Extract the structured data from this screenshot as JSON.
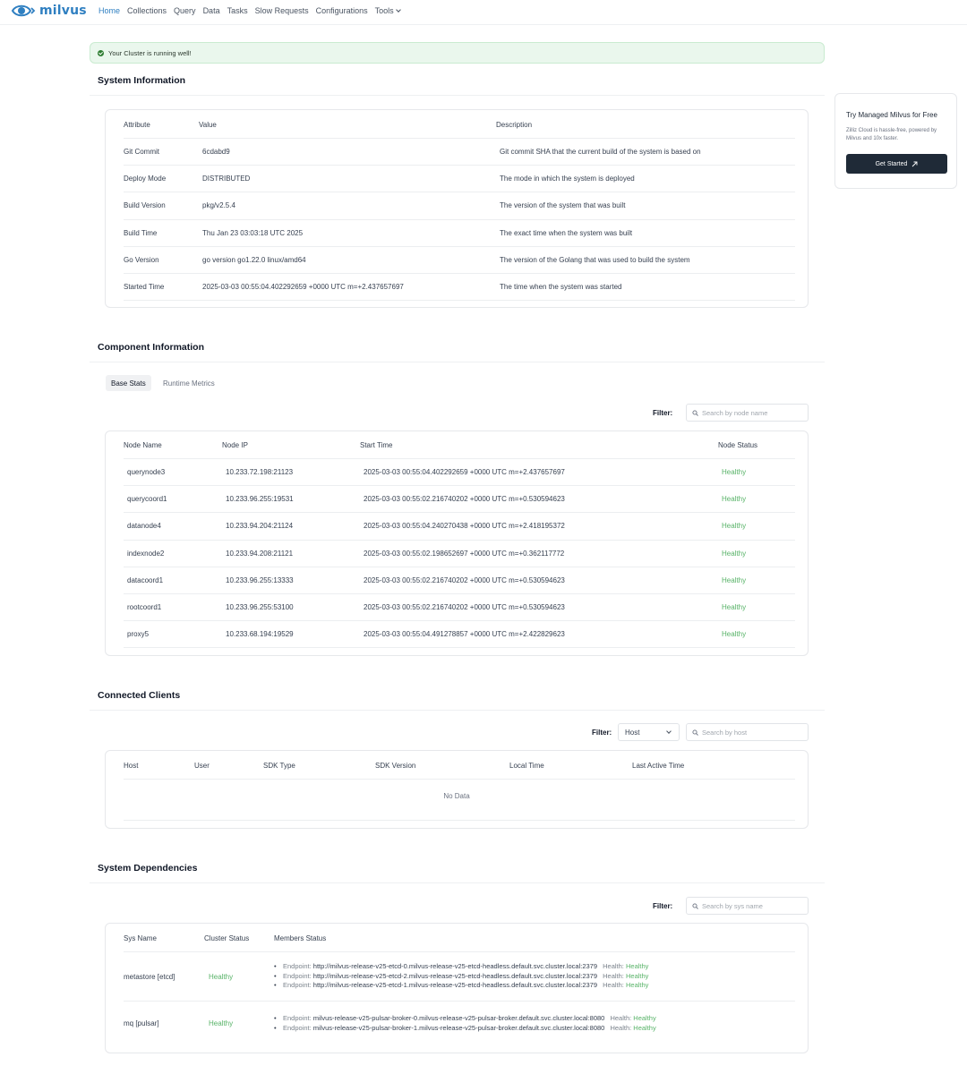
{
  "brand": {
    "name": "milvus"
  },
  "nav": {
    "items": [
      "Home",
      "Collections",
      "Query",
      "Data",
      "Tasks",
      "Slow Requests",
      "Configurations",
      "Tools"
    ]
  },
  "alert": {
    "text": "Your Cluster is running well!"
  },
  "system_info": {
    "title": "System Information",
    "headers": [
      "Attribute",
      "Value",
      "Description"
    ],
    "rows": [
      [
        "Git Commit",
        "6cdabd9",
        "Git commit SHA that the current build of the system is based on"
      ],
      [
        "Deploy Mode",
        "DISTRIBUTED",
        "The mode in which the system is deployed"
      ],
      [
        "Build Version",
        "pkg/v2.5.4",
        "The version of the system that was built"
      ],
      [
        "Build Time",
        "Thu Jan 23 03:03:18 UTC 2025",
        "The exact time when the system was built"
      ],
      [
        "Go Version",
        "go version go1.22.0 linux/amd64",
        "The version of the Golang that was used to build the system"
      ],
      [
        "Started Time",
        "2025-03-03 00:55:04.402292659 +0000 UTC m=+2.437657697",
        "The time when the system was started"
      ]
    ]
  },
  "promo": {
    "title": "Try Managed Milvus for Free",
    "desc": "Zilliz Cloud is hassle-free, powered by Milvus and 10x faster.",
    "button": "Get Started"
  },
  "components": {
    "title": "Component Information",
    "tabs": [
      "Base Stats",
      "Runtime Metrics"
    ],
    "filter_label": "Filter:",
    "search_placeholder": "Search by node name",
    "headers": [
      "Node Name",
      "Node IP",
      "Start Time",
      "Node Status"
    ],
    "rows": [
      [
        "querynode3",
        "10.233.72.198:21123",
        "2025-03-03 00:55:04.402292659 +0000 UTC m=+2.437657697",
        "Healthy"
      ],
      [
        "querycoord1",
        "10.233.96.255:19531",
        "2025-03-03 00:55:02.216740202 +0000 UTC m=+0.530594623",
        "Healthy"
      ],
      [
        "datanode4",
        "10.233.94.204:21124",
        "2025-03-03 00:55:04.240270438 +0000 UTC m=+2.418195372",
        "Healthy"
      ],
      [
        "indexnode2",
        "10.233.94.208:21121",
        "2025-03-03 00:55:02.198652697 +0000 UTC m=+0.362117772",
        "Healthy"
      ],
      [
        "datacoord1",
        "10.233.96.255:13333",
        "2025-03-03 00:55:02.216740202 +0000 UTC m=+0.530594623",
        "Healthy"
      ],
      [
        "rootcoord1",
        "10.233.96.255:53100",
        "2025-03-03 00:55:02.216740202 +0000 UTC m=+0.530594623",
        "Healthy"
      ],
      [
        "proxy5",
        "10.233.68.194:19529",
        "2025-03-03 00:55:04.491278857 +0000 UTC m=+2.422829623",
        "Healthy"
      ]
    ]
  },
  "clients": {
    "title": "Connected Clients",
    "filter_label": "Filter:",
    "select_value": "Host",
    "search_placeholder": "Search by host",
    "headers": [
      "Host",
      "User",
      "SDK Type",
      "SDK Version",
      "Local Time",
      "Last Active Time"
    ],
    "empty": "No Data"
  },
  "dependencies": {
    "title": "System Dependencies",
    "filter_label": "Filter:",
    "search_placeholder": "Search by sys name",
    "headers": [
      "Sys Name",
      "Cluster Status",
      "Members Status"
    ],
    "endpoint_label": "Endpoint:",
    "health_label": "Health:",
    "rows": [
      {
        "name": "metastore [etcd]",
        "status": "Healthy",
        "members": [
          {
            "endpoint": "http://milvus-release-v25-etcd-0.milvus-release-v25-etcd-headless.default.svc.cluster.local:2379",
            "health": "Healthy"
          },
          {
            "endpoint": "http://milvus-release-v25-etcd-2.milvus-release-v25-etcd-headless.default.svc.cluster.local:2379",
            "health": "Healthy"
          },
          {
            "endpoint": "http://milvus-release-v25-etcd-1.milvus-release-v25-etcd-headless.default.svc.cluster.local:2379",
            "health": "Healthy"
          }
        ]
      },
      {
        "name": "mq [pulsar]",
        "status": "Healthy",
        "members": [
          {
            "endpoint": "milvus-release-v25-pulsar-broker-0.milvus-release-v25-pulsar-broker.default.svc.cluster.local:8080",
            "health": "Healthy"
          },
          {
            "endpoint": "milvus-release-v25-pulsar-broker-1.milvus-release-v25-pulsar-broker.default.svc.cluster.local:8080",
            "health": "Healthy"
          }
        ]
      }
    ]
  },
  "colors": {
    "brand": "#2f7fc1",
    "healthy": "#58b368",
    "button_dark": "#1f2a37",
    "alert_bg": "#eaf7ed"
  },
  "icons": [
    "milvus-logo-icon",
    "check-circle-icon",
    "chevron-down-icon",
    "search-icon",
    "external-link-icon"
  ]
}
